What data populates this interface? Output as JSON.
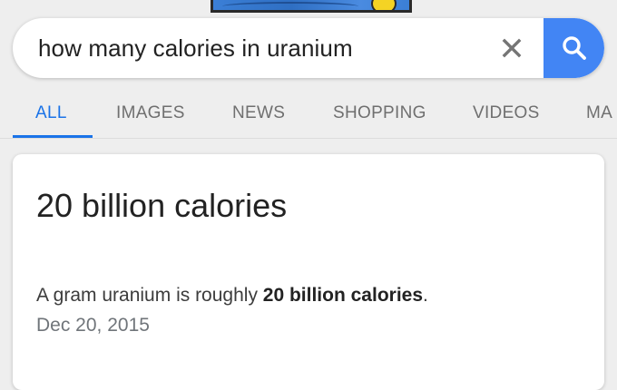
{
  "search": {
    "query": "how many calories in uranium"
  },
  "tabs": [
    {
      "label": "ALL",
      "active": true
    },
    {
      "label": "IMAGES",
      "active": false
    },
    {
      "label": "NEWS",
      "active": false
    },
    {
      "label": "SHOPPING",
      "active": false
    },
    {
      "label": "VIDEOS",
      "active": false
    },
    {
      "label": "MA",
      "active": false
    }
  ],
  "answer": {
    "heading": "20 billion calories",
    "snippet_prefix": "A gram uranium is roughly ",
    "snippet_bold": "20 billion calories",
    "snippet_suffix": ".",
    "date": "Dec 20, 2015"
  },
  "icons": {
    "clear": "close-icon",
    "search": "search-icon"
  },
  "colors": {
    "accent": "#1a73e8",
    "search_button": "#4285f4",
    "background": "#eeeeee"
  }
}
